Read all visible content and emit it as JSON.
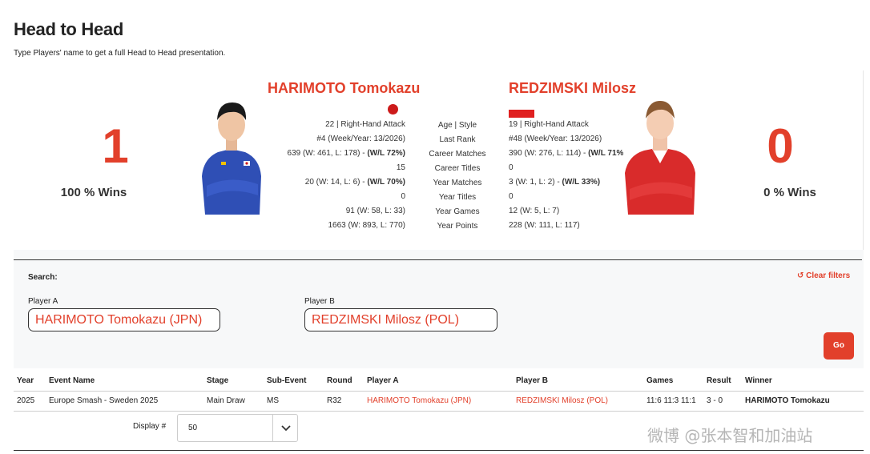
{
  "header": {
    "title": "Head to Head",
    "subtitle": "Type Players' name to get a full Head to Head presentation."
  },
  "player_a": {
    "name": "HARIMOTO Tomokazu",
    "wins": "1",
    "wins_label": "100 % Wins",
    "stats": [
      "22 | Right-Hand Attack",
      "#4 (Week/Year: 13/2026)",
      "639 (W: 461, L: 178) - ",
      "15",
      "20 (W: 14, L: 6) - ",
      "0",
      "91 (W: 58, L: 33)",
      "1663 (W: 893, L: 770)"
    ],
    "career_wl": "(W/L 72%)",
    "year_wl": "(W/L 70%)",
    "flag_color": "#cc1a1a"
  },
  "player_b": {
    "name": "REDZIMSKI Milosz",
    "wins": "0",
    "wins_label": "0 % Wins",
    "stats": [
      "19 | Right-Hand Attack",
      "#48 (Week/Year: 13/2026)",
      "390 (W: 276, L: 114) - ",
      "0",
      "3 (W: 1, L: 2) - ",
      "0",
      "12 (W: 5, L: 7)",
      "228 (W: 111, L: 117)"
    ],
    "career_wl": "(W/L 71%)",
    "year_wl": "(W/L 33%)",
    "flag_color": "#e02020"
  },
  "stat_labels": [
    "Age | Style",
    "Last Rank",
    "Career Matches",
    "Career Titles",
    "Year Matches",
    "Year Titles",
    "Year Games",
    "Year Points"
  ],
  "filters": {
    "search_label": "Search:",
    "clear_label": "Clear filters",
    "player_a_label": "Player A",
    "player_a_value": "HARIMOTO Tomokazu (JPN)",
    "player_b_label": "Player B",
    "player_b_value": "REDZIMSKI Milosz (POL)",
    "go_label": "Go"
  },
  "table": {
    "headers": [
      "Year",
      "Event Name",
      "Stage",
      "Sub-Event",
      "Round",
      "Player A",
      "Player B",
      "Games",
      "Result",
      "Winner"
    ],
    "rows": [
      [
        "2025",
        "Europe Smash - Sweden 2025",
        "Main Draw",
        "MS",
        "R32",
        "HARIMOTO Tomokazu (JPN)",
        "REDZIMSKI Milosz (POL)",
        "11:6 11:3 11:1",
        "3 - 0",
        "HARIMOTO Tomokazu"
      ]
    ]
  },
  "display": {
    "label": "Display #",
    "value": "50"
  },
  "watermark": "微博 @张本智和加油站",
  "colors": {
    "accent": "#e2402b",
    "filter_bg": "#f7f8f9"
  }
}
